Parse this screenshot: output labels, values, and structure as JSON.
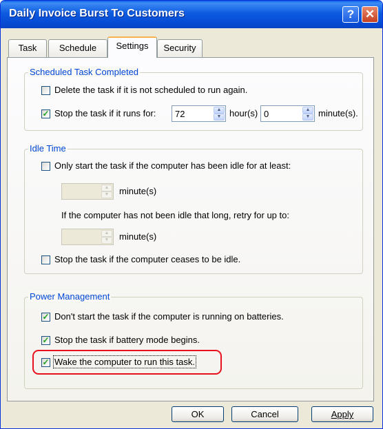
{
  "window": {
    "title": "Daily Invoice Burst To Customers"
  },
  "tabs": [
    "Task",
    "Schedule",
    "Settings",
    "Security"
  ],
  "scheduled": {
    "legend": "Scheduled Task Completed",
    "delete_label": "Delete the task if it is not scheduled to run again.",
    "stop_label": "Stop the task if it runs for:",
    "hours_value": "72",
    "hours_unit": "hour(s)",
    "minutes_value": "0",
    "minutes_unit": "minute(s)."
  },
  "idle": {
    "legend": "Idle Time",
    "only_start_label": "Only start the task if the computer has been idle for at least:",
    "minutes_label_1": "minute(s)",
    "retry_text": "If the computer has not been idle that long, retry for up to:",
    "minutes_label_2": "minute(s)",
    "stop_idle_label": "Stop the task if the computer ceases to be idle."
  },
  "power": {
    "legend": "Power Management",
    "no_batteries_label": "Don't start the task if the computer is running on batteries.",
    "battery_mode_label": "Stop the task if battery mode begins.",
    "wake_label": "Wake the computer to run this task."
  },
  "buttons": {
    "ok": "OK",
    "cancel": "Cancel",
    "apply": "Apply"
  },
  "colors": {
    "title_bar": "#0a5fe6",
    "highlight": "#e8101a",
    "legend": "#0046d5"
  }
}
